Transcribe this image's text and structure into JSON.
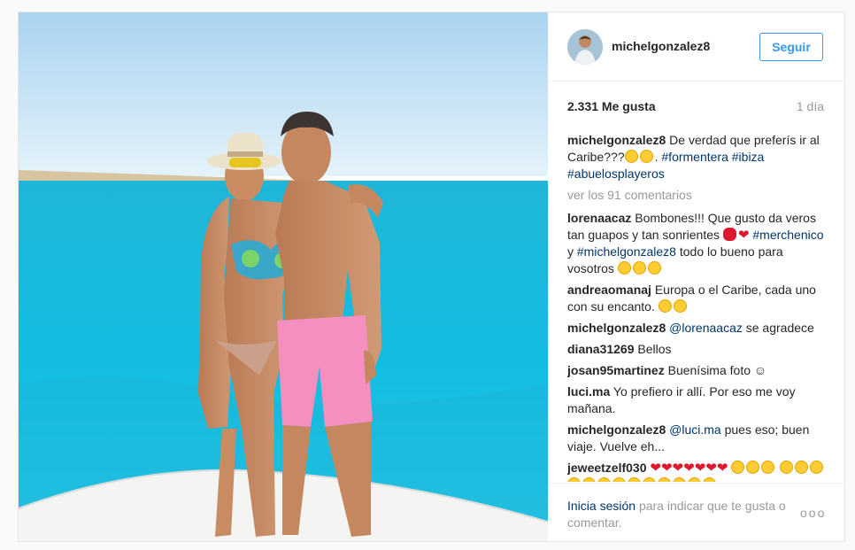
{
  "user": {
    "username": "michelgonzalez8",
    "follow_label": "Seguir"
  },
  "stats": {
    "likes": "2.331 Me gusta",
    "time": "1 día"
  },
  "caption": {
    "author": "michelgonzalez8",
    "text": "De verdad que preferís ir al Caribe???",
    "tags": [
      "#formentera",
      "#ibiza",
      "#abuelosplayeros"
    ]
  },
  "view_more": "ver los 91 comentarios",
  "comments": [
    {
      "author": "lorenaacaz",
      "text_1": "Bombones!!! Que gusto da veros tan guapos y tan sonrientes",
      "tag_1": "#merchenico",
      "text_2": "y",
      "tag_2": "#michelgonzalez8",
      "text_3": "todo lo bueno para vosotros"
    },
    {
      "author": "andreaomanaj",
      "text": "Europa o el Caribe, cada uno con su encanto."
    },
    {
      "author": "michelgonzalez8",
      "mention": "@lorenaacaz",
      "text": "se agradece"
    },
    {
      "author": "diana31269",
      "text": "Bellos"
    },
    {
      "author": "josan95martinez",
      "text": "Buenísima foto ☺"
    },
    {
      "author": "luci.ma",
      "text": "Yo prefiero ir allí. Por eso me voy mañana."
    },
    {
      "author": "michelgonzalez8",
      "mention": "@luci.ma",
      "text": "pues eso; buen viaje. Vuelve eh..."
    },
    {
      "author": "jeweetzelf030"
    }
  ],
  "footer": {
    "login_label": "Inicia sesión",
    "text": "para indicar que te gusta o comentar.",
    "options": "ooo"
  },
  "colors": {
    "accent": "#3897f0",
    "link": "#003569",
    "muted": "#999999",
    "heart": "#e0182d"
  },
  "icons": [
    "avatar-image",
    "sunglasses-emoji",
    "kiss-emoji",
    "heart-emoji",
    "heart-eyes-emoji",
    "wink-emoji",
    "more-options-icon"
  ]
}
